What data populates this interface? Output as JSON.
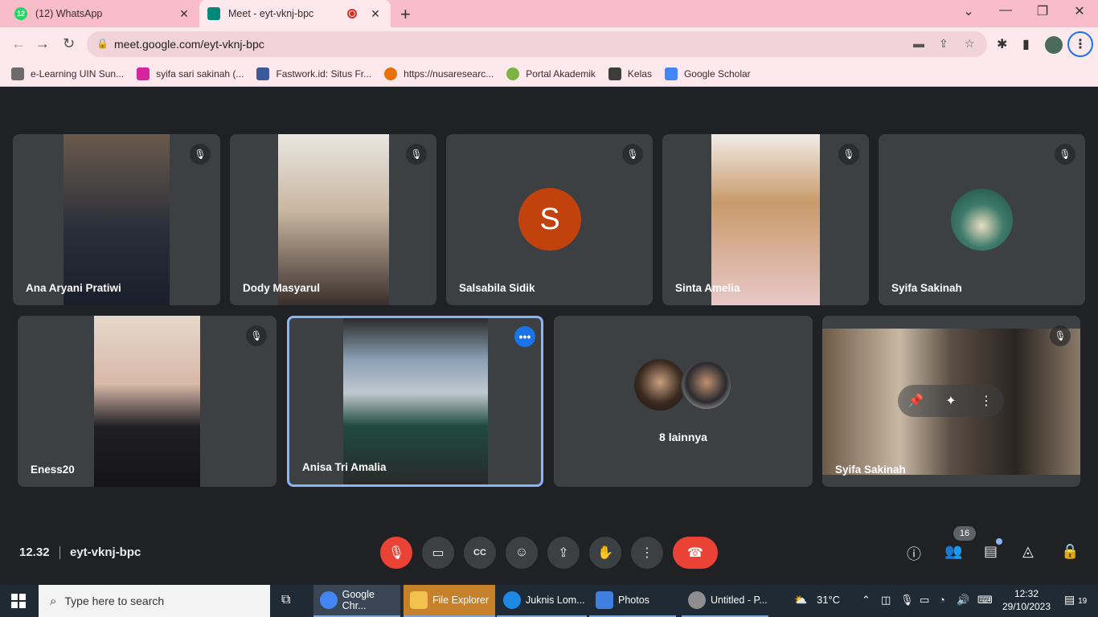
{
  "browser": {
    "tabs": [
      {
        "title": "(12) WhatsApp",
        "badge": "12",
        "color": "#25d366"
      },
      {
        "title": "Meet - eyt-vknj-bpc",
        "color": "#00897b"
      }
    ],
    "url": "meet.google.com/eyt-vknj-bpc",
    "bookmarks": [
      {
        "label": "e-Learning UIN Sun...",
        "color": "#6b6b6b"
      },
      {
        "label": "syifa sari sakinah (...",
        "color": "#d6249f"
      },
      {
        "label": "Fastwork.id: Situs Fr...",
        "color": "#3a5a9c"
      },
      {
        "label": "https://nusaresearc...",
        "color": "#e8710a"
      },
      {
        "label": "Portal Akademik",
        "color": "#7cb342"
      },
      {
        "label": "Kelas",
        "color": "#3c3c3c"
      },
      {
        "label": "Google Scholar",
        "color": "#4285f4"
      }
    ]
  },
  "meet": {
    "participants_row1": [
      {
        "name": "Ana Aryani Pratiwi"
      },
      {
        "name": "Dody Masyarul"
      },
      {
        "name": "Salsabila Sidik",
        "initial": "S"
      },
      {
        "name": "Sinta Amelia"
      },
      {
        "name": "Syifa Sakinah"
      }
    ],
    "participants_row2": [
      {
        "name": "Eness20"
      },
      {
        "name": "Anisa Tri Amalia"
      },
      {
        "name": "8 lainnya"
      },
      {
        "name": "Syifa Sakinah"
      }
    ],
    "time": "12.32",
    "code": "eyt-vknj-bpc",
    "people_count": "16"
  },
  "taskbar": {
    "search_placeholder": "Type here to search",
    "apps": [
      {
        "label": "Google Chr...",
        "color": "#4285f4"
      },
      {
        "label": "File Explorer",
        "color": "#f2c14e"
      },
      {
        "label": "Juknis Lom...",
        "color": "#1e88e5"
      },
      {
        "label": "Photos",
        "color": "#3f7fe0"
      },
      {
        "label": "Untitled - P...",
        "color": "#8e8e8e"
      }
    ],
    "weather": "31°C",
    "clock_time": "12:32",
    "clock_date": "29/10/2023",
    "notifications": "19"
  }
}
